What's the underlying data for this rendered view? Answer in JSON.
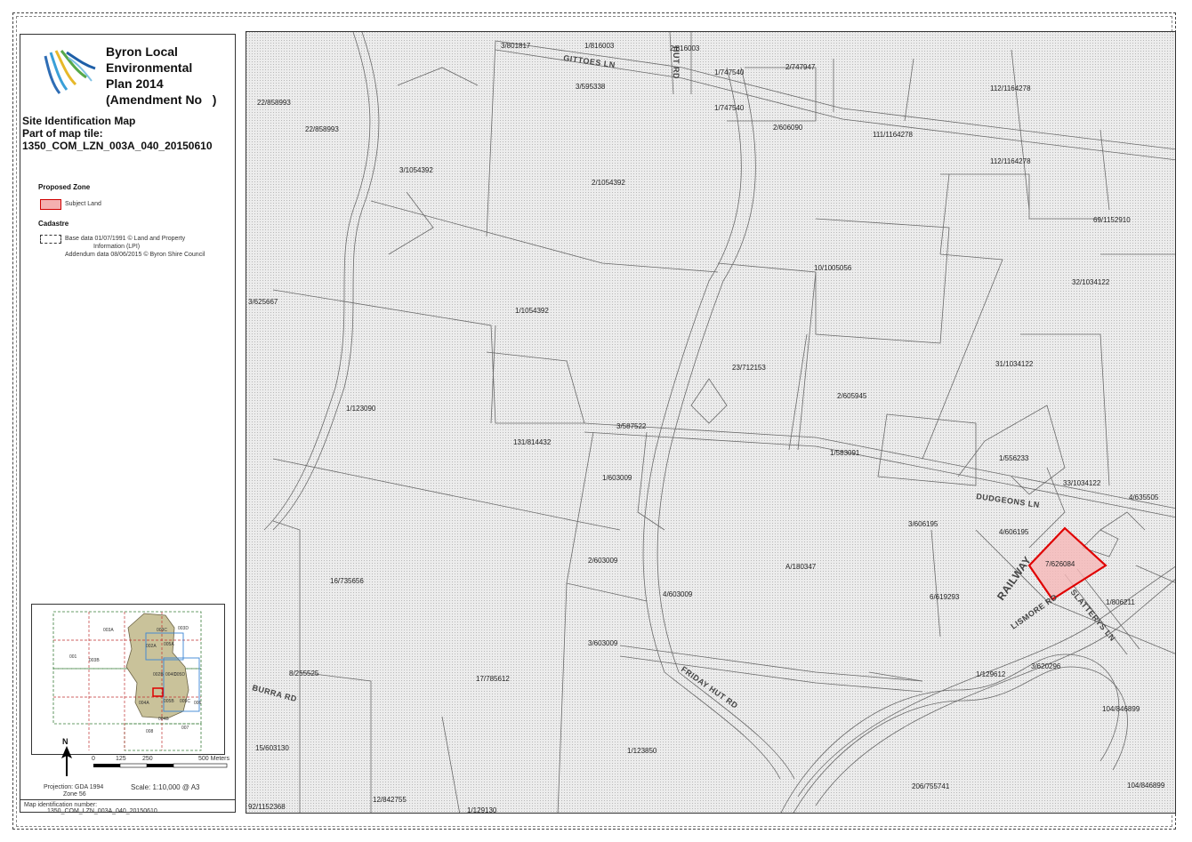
{
  "title": "Byron Local\nEnvironmental\nPlan 2014\n(Amendment No   )",
  "map_heading": "Site Identification Map",
  "tile_heading": "Part of map tile:",
  "tile_code": "1350_COM_LZN_003A_040_20150610",
  "legend": {
    "zone_heading": "Proposed Zone",
    "zone_item": "Subject Land",
    "cadastre_heading": "Cadastre",
    "cadastre_line1": "Base data 01/07/1991 © Land and Property",
    "cadastre_line2": "Information (LPI)",
    "cadastre_line3": "Addendum data 08/06/2015 © Byron Shire Council"
  },
  "inset_labels": [
    "003A",
    "003B",
    "003C",
    "003D",
    "001",
    "002A",
    "002B",
    "004A",
    "004B",
    "004C",
    "005A",
    "005B",
    "005C",
    "005D",
    "006",
    "007",
    "008"
  ],
  "north": "N",
  "scale_ticks": [
    "0",
    "125",
    "250",
    "",
    "500 Meters"
  ],
  "projection_line1": "Projection: GDA 1994",
  "projection_line2": "Zone 56",
  "scale_text": "Scale: 1:10,000 @ A3",
  "footer_line1": "Map identification number:",
  "footer_line2": "1350_COM_LZN_003A_040_20150610",
  "roads": [
    "GITTOES LN",
    "HUT RD",
    "DUDGEONS LN",
    "RAILWAY",
    "LISMORE RD",
    "SLATTERYS LN",
    "FRIDAY HUT RD",
    "BURRA RD"
  ],
  "lots": [
    "3/801817",
    "1/816003",
    "2/816003",
    "1/747540",
    "2/747947",
    "3/595338",
    "1/747540",
    "2/606090",
    "112/1164278",
    "111/1164278",
    "112/1164278",
    "22/858993",
    "22/858993",
    "3/1054392",
    "2/1054392",
    "69/1152910",
    "10/1005056",
    "32/1034122",
    "3/625667",
    "1/1054392",
    "23/712153",
    "31/1034122",
    "2/605945",
    "1/123090",
    "3/587522",
    "131/814432",
    "1/583091",
    "1/556233",
    "1/603009",
    "33/1034122",
    "4/635505",
    "3/606195",
    "4/606195",
    "7/626084",
    "2/603009",
    "16/735656",
    "A/180347",
    "4/603009",
    "6/619293",
    "1/806211",
    "3/603009",
    "8/255525",
    "17/785612",
    "1/129612",
    "3/620296",
    "104/846899",
    "15/603130",
    "1/123850",
    "12/842755",
    "206/755741",
    "104/846899",
    "92/1152368",
    "1/129130"
  ]
}
